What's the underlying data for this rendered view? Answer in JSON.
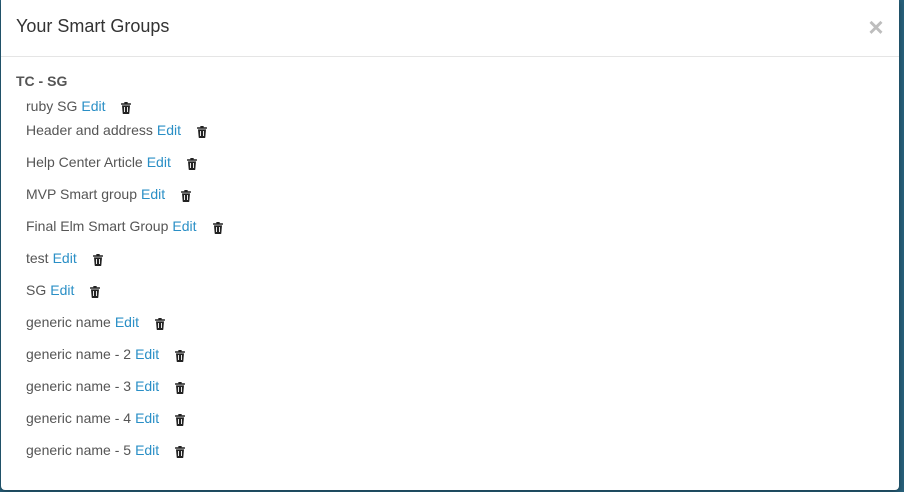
{
  "modal": {
    "title": "Your Smart Groups",
    "close_label": "×"
  },
  "group": {
    "title": "TC - SG",
    "items": [
      {
        "name": "ruby SG",
        "edit_label": "Edit",
        "delete_icon": "trash-icon"
      },
      {
        "name": "Header and address",
        "edit_label": "Edit",
        "delete_icon": "trash-icon"
      },
      {
        "name": "Help Center Article",
        "edit_label": "Edit",
        "delete_icon": "trash-icon"
      },
      {
        "name": "MVP Smart group",
        "edit_label": "Edit",
        "delete_icon": "trash-icon"
      },
      {
        "name": "Final Elm Smart Group",
        "edit_label": "Edit",
        "delete_icon": "trash-icon"
      },
      {
        "name": "test",
        "edit_label": "Edit",
        "delete_icon": "trash-icon"
      },
      {
        "name": "SG",
        "edit_label": "Edit",
        "delete_icon": "trash-icon"
      },
      {
        "name": "generic name",
        "edit_label": "Edit",
        "delete_icon": "trash-icon"
      },
      {
        "name": "generic name - 2",
        "edit_label": "Edit",
        "delete_icon": "trash-icon"
      },
      {
        "name": "generic name - 3",
        "edit_label": "Edit",
        "delete_icon": "trash-icon"
      },
      {
        "name": "generic name - 4",
        "edit_label": "Edit",
        "delete_icon": "trash-icon"
      },
      {
        "name": "generic name - 5",
        "edit_label": "Edit",
        "delete_icon": "trash-icon"
      }
    ]
  },
  "colors": {
    "link": "#2a8fc6",
    "text": "#555555",
    "title": "#333333",
    "close": "#bdbdbd"
  }
}
